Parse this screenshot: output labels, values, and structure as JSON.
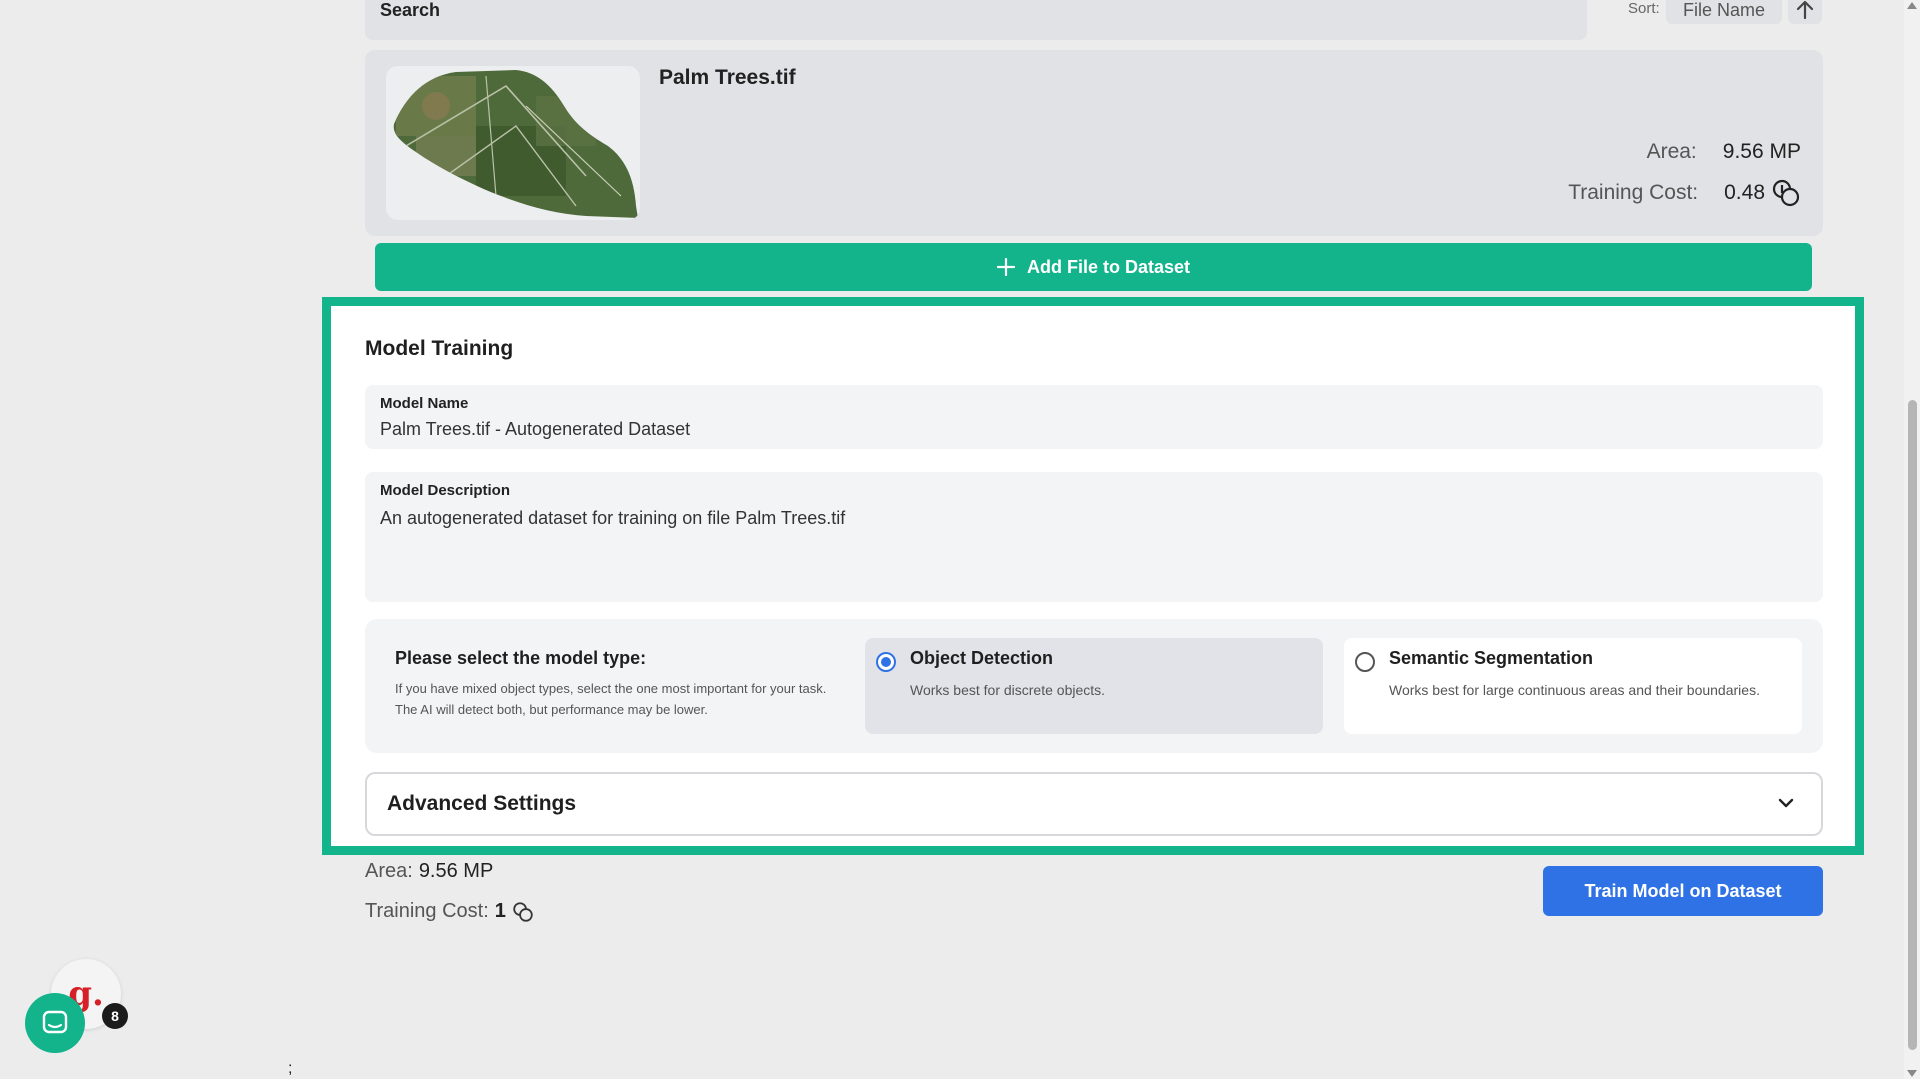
{
  "search": {
    "label": "Search"
  },
  "sort": {
    "label": "Sort:",
    "value": "File Name",
    "direction": "ascending",
    "direction_icon": "arrow-up-icon"
  },
  "file": {
    "name": "Palm Trees.tif",
    "area_label": "Area:",
    "area_value": "9.56 MP",
    "cost_label": "Training Cost:",
    "cost_value": "0.48",
    "cost_icon": "coins-icon"
  },
  "add_file": {
    "label": "Add File to Dataset",
    "icon": "plus-icon"
  },
  "training": {
    "title": "Model Training",
    "model_name_label": "Model Name",
    "model_name_value": "Palm Trees.tif - Autogenerated Dataset",
    "model_desc_label": "Model Description",
    "model_desc_value": "An autogenerated dataset for training on file Palm Trees.tif",
    "type_question": "Please select the model type:",
    "type_hint": "If you have mixed object types, select the one most important for your task. The AI will detect both, but performance may be lower.",
    "options": [
      {
        "title": "Object Detection",
        "desc": "Works best for discrete objects.",
        "selected": true
      },
      {
        "title": "Semantic Segmentation",
        "desc": "Works best for large continuous areas and their boundaries.",
        "selected": false
      }
    ],
    "advanced_label": "Advanced Settings",
    "advanced_icon": "chevron-down-icon"
  },
  "summary": {
    "area_label": "Area:",
    "area_value": "9.56 MP",
    "cost_label": "Training Cost:",
    "cost_value": "1",
    "cost_icon": "coins-icon"
  },
  "train_button": {
    "label": "Train Model on Dataset"
  },
  "widgets": {
    "g_logo": "g.",
    "notification_count": "8",
    "stray_char": ";"
  },
  "colors": {
    "accent_green": "#13b38c",
    "primary_blue": "#2f72e6",
    "panel_bg": "#e1e2e5",
    "brand_red": "#d61f26"
  }
}
